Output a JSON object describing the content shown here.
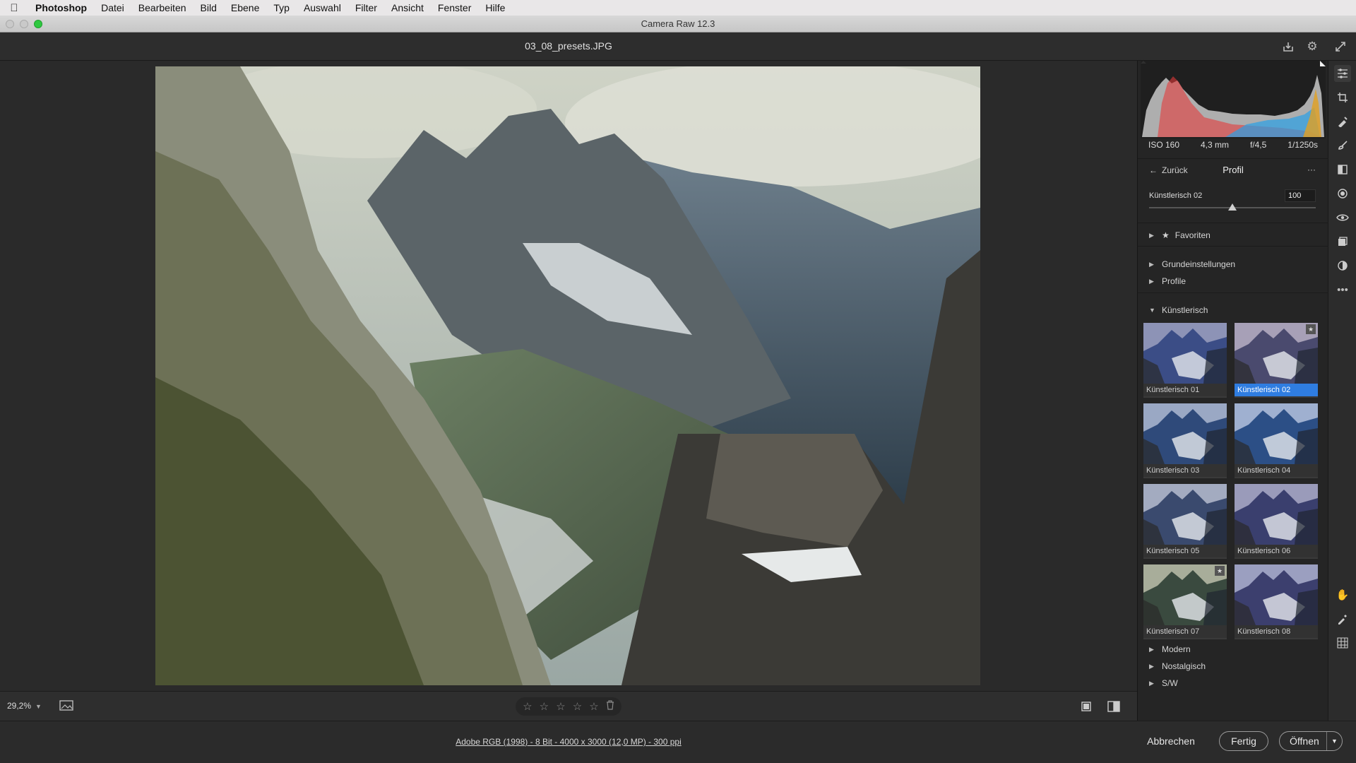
{
  "menubar": {
    "apple": "",
    "app_name": "Photoshop",
    "items": [
      "Datei",
      "Bearbeiten",
      "Bild",
      "Ebene",
      "Typ",
      "Auswahl",
      "Filter",
      "Ansicht",
      "Fenster",
      "Hilfe"
    ]
  },
  "window": {
    "title": "Camera Raw 12.3"
  },
  "header": {
    "filename": "03_08_presets.JPG"
  },
  "bottom": {
    "zoom": "29,2%",
    "rating_stars": 5
  },
  "status": {
    "workflow": "Adobe RGB (1998) - 8 Bit - 4000 x 3000 (12,0 MP) - 300 ppi",
    "cancel": "Abbrechen",
    "done": "Fertig",
    "open": "Öffnen"
  },
  "exif": {
    "iso": "ISO 160",
    "focal": "4,3 mm",
    "aperture": "f/4,5",
    "shutter": "1/1250s"
  },
  "panel": {
    "back": "Zurück",
    "title": "Profil",
    "more": "···",
    "profile_name": "Künstlerisch 02",
    "amount": "100",
    "amount_fraction": 0.5,
    "groups": {
      "favorites": "Favoriten",
      "basic": "Grundeinstellungen",
      "profiles": "Profile",
      "artistic": "Künstlerisch",
      "modern": "Modern",
      "nostalgic": "Nostalgisch",
      "bw": "S/W"
    },
    "thumbs": [
      {
        "label": "Künstlerisch 01",
        "selected": false,
        "fav": false
      },
      {
        "label": "Künstlerisch 02",
        "selected": true,
        "fav": true
      },
      {
        "label": "Künstlerisch 03",
        "selected": false,
        "fav": false
      },
      {
        "label": "Künstlerisch 04",
        "selected": false,
        "fav": false
      },
      {
        "label": "Künstlerisch 05",
        "selected": false,
        "fav": false
      },
      {
        "label": "Künstlerisch 06",
        "selected": false,
        "fav": false
      },
      {
        "label": "Künstlerisch 07",
        "selected": false,
        "fav": true
      },
      {
        "label": "Künstlerisch 08",
        "selected": false,
        "fav": false
      }
    ]
  },
  "colors": {
    "accent": "#2f7de1",
    "traffic_green": "#2fc840"
  }
}
